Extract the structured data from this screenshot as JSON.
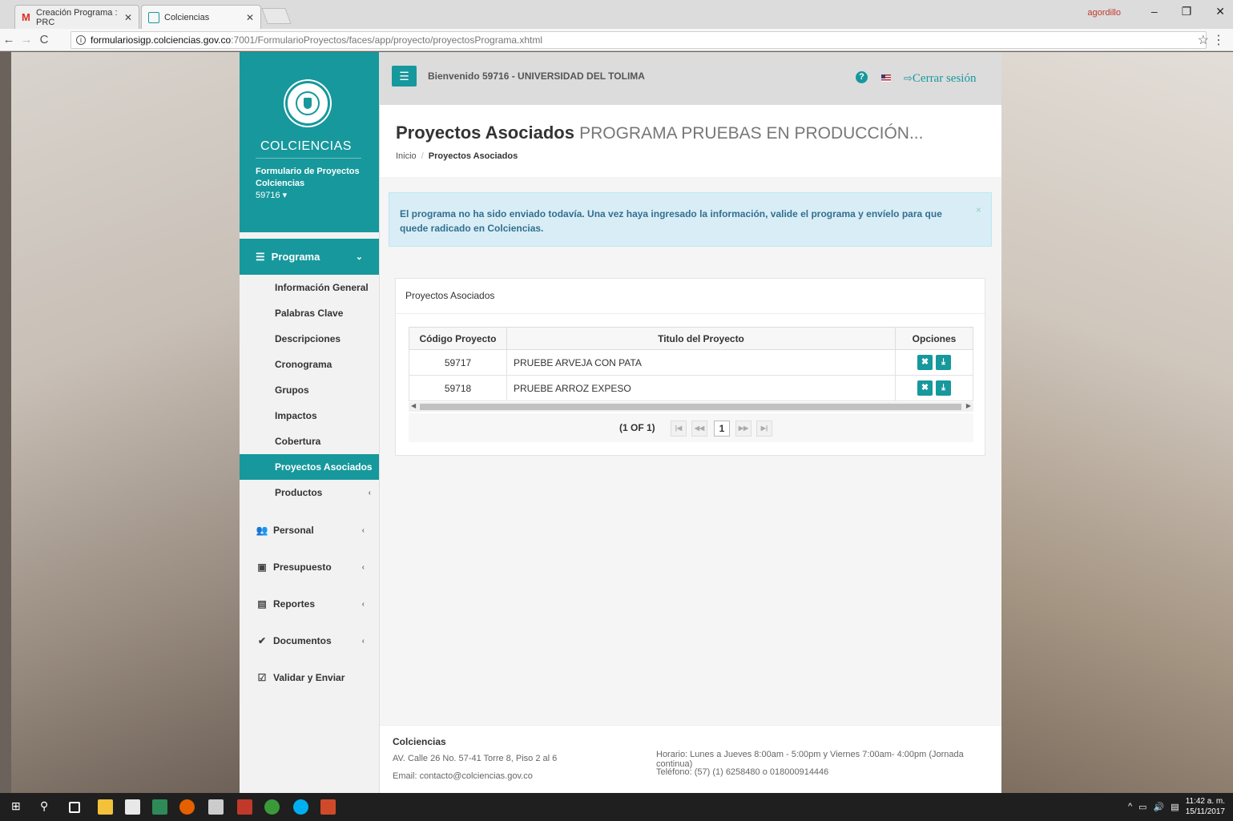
{
  "browser": {
    "tabs": [
      {
        "label": "Creación Programa : PRC"
      },
      {
        "label": "Colciencias"
      }
    ],
    "profile": "agordillo",
    "url_host": "formulariosigp.colciencias.gov.co",
    "url_path": ":7001/FormularioProyectos/faces/app/proyecto/proyectosPrograma.xhtml"
  },
  "sidebar": {
    "brand": "COLCIENCIAS",
    "subtitle_line1": "Formulario de Proyectos",
    "subtitle_line2": "Colciencias",
    "user_id": "59716 ▾",
    "section": {
      "label": "Programa"
    },
    "submenu": [
      {
        "label": "Información General"
      },
      {
        "label": "Palabras Clave"
      },
      {
        "label": "Descripciones"
      },
      {
        "label": "Cronograma"
      },
      {
        "label": "Grupos"
      },
      {
        "label": "Impactos"
      },
      {
        "label": "Cobertura"
      },
      {
        "label": "Proyectos Asociados"
      },
      {
        "label": "Productos"
      }
    ],
    "groups": [
      {
        "label": "Personal",
        "icon": "users-icon"
      },
      {
        "label": "Presupuesto",
        "icon": "money-icon"
      },
      {
        "label": "Reportes",
        "icon": "file-icon"
      },
      {
        "label": "Documentos",
        "icon": "check-circle-icon"
      },
      {
        "label": "Validar y Enviar",
        "icon": "check-square-icon"
      }
    ]
  },
  "topbar": {
    "welcome": "Bienvenido 59716 - UNIVERSIDAD DEL TOLIMA",
    "logout": "Cerrar sesión"
  },
  "header": {
    "title_bold": "Proyectos Asociados",
    "title_sub": "PROGRAMA PRUEBAS EN PRODUCCIÓN...",
    "breadcrumb_home": "Inicio",
    "breadcrumb_current": "Proyectos Asociados"
  },
  "alert": {
    "text": "El programa no ha sido enviado todavía. Una vez haya ingresado la información, valide el programa y envíelo para que quede radicado en Colciencias.",
    "close": "×"
  },
  "panel": {
    "title": "Proyectos Asociados",
    "columns": [
      "Código Proyecto",
      "Titulo del Proyecto",
      "Opciones"
    ],
    "rows": [
      {
        "code": "59717",
        "title": "PRUEBE ARVEJA CON PATA"
      },
      {
        "code": "59718",
        "title": "PRUEBE ARROZ EXPESO"
      }
    ],
    "pager_label": "(1 OF 1)",
    "current_page": "1"
  },
  "footer": {
    "org": "Colciencias",
    "address": "AV. Calle 26 No. 57-41 Torre 8, Piso 2 al 6",
    "email": "Email: contacto@colciencias.gov.co",
    "hours": "Horario: Lunes a Jueves 8:00am - 5:00pm y Viernes 7:00am- 4:00pm (Jornada continua)",
    "phone": "Teléfono: (57) (1) 6258480 o 018000914446"
  },
  "taskbar": {
    "time": "11:42 a. m.",
    "date": "15/11/2017"
  },
  "colors": {
    "accent": "#17989c",
    "alert_bg": "#d9edf7"
  }
}
